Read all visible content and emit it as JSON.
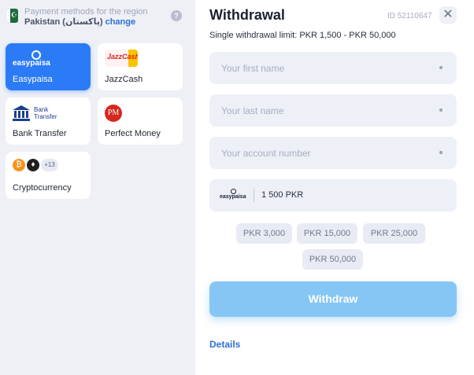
{
  "region": {
    "caption": "Payment methods for the region",
    "country": "Pakistan (پاکستان)",
    "change_link": "change",
    "help_glyph": "?"
  },
  "methods": [
    {
      "label": "Easypaisa",
      "logo_text": "easypaisa",
      "active": true,
      "icon": "easypaisa-logo"
    },
    {
      "label": "JazzCash",
      "logo_text": "JazzCash",
      "active": false,
      "icon": "jazzcash-logo"
    },
    {
      "label": "Bank Transfer",
      "logo_text": "Bank Transfer",
      "active": false,
      "icon": "bank-icon"
    },
    {
      "label": "Perfect Money",
      "logo_text": "PM",
      "active": false,
      "icon": "perfect-money-logo"
    },
    {
      "label": "Cryptocurrency",
      "extra_count": "+13",
      "active": false,
      "icon": "crypto-icons"
    }
  ],
  "withdrawal": {
    "title": "Withdrawal",
    "id_label": "ID 52110647",
    "close_glyph": "✕",
    "limit_text": "Single withdrawal limit: PKR 1,500 - PKR 50,000",
    "fields": {
      "first_name_placeholder": "Your first name",
      "last_name_placeholder": "Your last name",
      "account_placeholder": "Your account number"
    },
    "amount": {
      "logo_text": "easypaisa",
      "value": "1 500 PKR"
    },
    "presets": [
      "PKR 3,000",
      "PKR 15,000",
      "PKR 25,000",
      "PKR 50,000"
    ],
    "submit_label": "Withdraw",
    "details_link": "Details"
  },
  "colors": {
    "accent": "#2b7bf6",
    "submit_button": "#86c6f5",
    "link": "#2e6fd8",
    "panel_background": "#eef0f6"
  }
}
